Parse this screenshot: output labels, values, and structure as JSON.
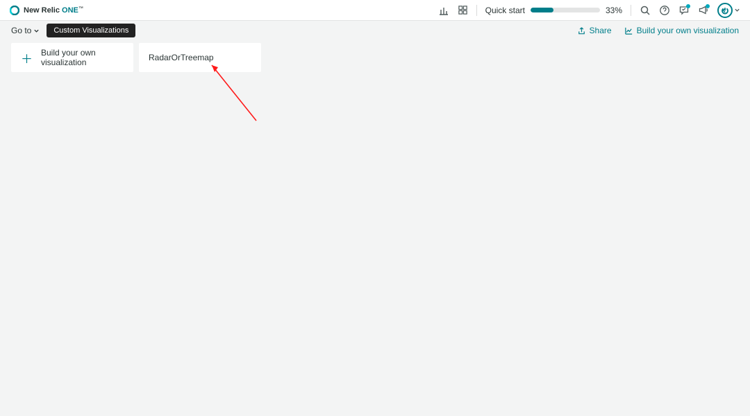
{
  "brand": {
    "prefix": "New Relic",
    "suffix": "ONE",
    "tm": "™"
  },
  "header": {
    "quickstart_label": "Quick start",
    "quickstart_pct": "33%",
    "quickstart_fill": 33
  },
  "subbar": {
    "goto": "Go to",
    "tag": "Custom Visualizations",
    "share": "Share",
    "build": "Build your own visualization"
  },
  "cards": {
    "build": "Build your own visualization",
    "radar": "RadarOrTreemap"
  }
}
